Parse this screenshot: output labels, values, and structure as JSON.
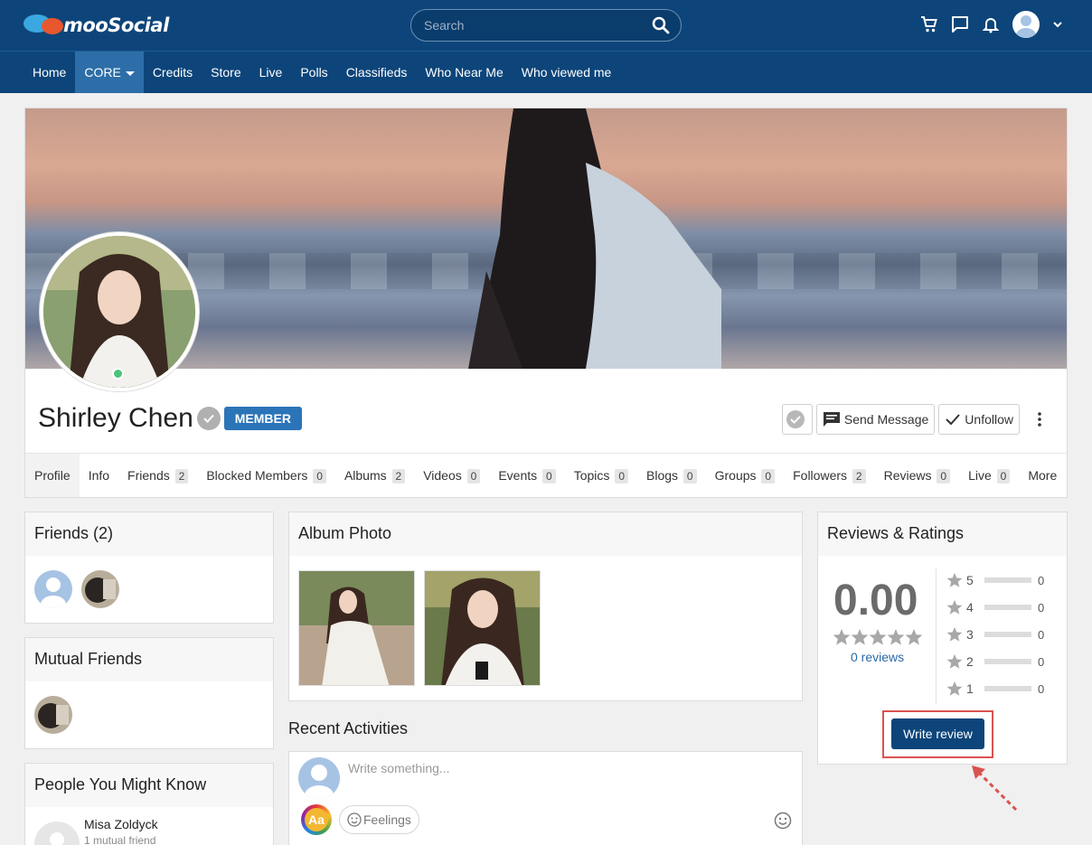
{
  "header": {
    "logo_text": "mooSocial",
    "search_placeholder": "Search"
  },
  "nav": {
    "items": [
      {
        "label": "Home"
      },
      {
        "label": "CORE"
      },
      {
        "label": "Credits"
      },
      {
        "label": "Store"
      },
      {
        "label": "Live"
      },
      {
        "label": "Polls"
      },
      {
        "label": "Classifieds"
      },
      {
        "label": "Who Near Me"
      },
      {
        "label": "Who viewed me"
      }
    ]
  },
  "profile": {
    "name": "Shirley Chen",
    "badge": "MEMBER",
    "send_message": "Send Message",
    "unfollow": "Unfollow",
    "tabs": [
      {
        "label": "Profile",
        "count": ""
      },
      {
        "label": "Info",
        "count": ""
      },
      {
        "label": "Friends",
        "count": "2"
      },
      {
        "label": "Blocked Members",
        "count": "0"
      },
      {
        "label": "Albums",
        "count": "2"
      },
      {
        "label": "Videos",
        "count": "0"
      },
      {
        "label": "Events",
        "count": "0"
      },
      {
        "label": "Topics",
        "count": "0"
      },
      {
        "label": "Blogs",
        "count": "0"
      },
      {
        "label": "Groups",
        "count": "0"
      },
      {
        "label": "Followers",
        "count": "2"
      },
      {
        "label": "Reviews",
        "count": "0"
      },
      {
        "label": "Live",
        "count": "0"
      },
      {
        "label": "More",
        "count": ""
      }
    ]
  },
  "friends": {
    "title": "Friends (2)"
  },
  "mutual": {
    "title": "Mutual Friends"
  },
  "people": {
    "title": "People You Might Know",
    "name": "Misa Zoldyck",
    "mutual": "1 mutual friend"
  },
  "album": {
    "title": "Album Photo"
  },
  "activities": {
    "title": "Recent Activities",
    "placeholder": "Write something...",
    "aa": "Aa",
    "feelings": "Feelings"
  },
  "reviews": {
    "title": "Reviews & Ratings",
    "score": "0.00",
    "reviews_link": "0 reviews",
    "rows": [
      {
        "star": "5",
        "count": "0"
      },
      {
        "star": "4",
        "count": "0"
      },
      {
        "star": "3",
        "count": "0"
      },
      {
        "star": "2",
        "count": "0"
      },
      {
        "star": "1",
        "count": "0"
      }
    ],
    "write_review": "Write review"
  }
}
